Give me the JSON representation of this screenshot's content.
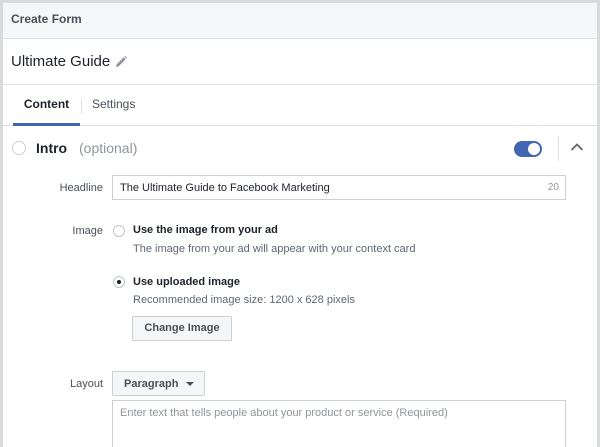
{
  "window": {
    "title": "Create Form"
  },
  "form": {
    "name": "Ultimate Guide"
  },
  "tabs": [
    {
      "label": "Content",
      "active": true
    },
    {
      "label": "Settings",
      "active": false
    }
  ],
  "section": {
    "title": "Intro",
    "optional_label": "(optional)",
    "enabled": true
  },
  "headline": {
    "label": "Headline",
    "value": "The Ultimate Guide to Facebook Marketing",
    "char_count": "20"
  },
  "image": {
    "label": "Image",
    "options": [
      {
        "title": "Use the image from your ad",
        "description": "The image from your ad will appear with your context card",
        "selected": false
      },
      {
        "title": "Use uploaded image",
        "description": "Recommended image size: 1200 x 628 pixels",
        "selected": true
      }
    ],
    "change_button": "Change Image"
  },
  "layout": {
    "label": "Layout",
    "selected": "Paragraph",
    "placeholder": "Enter text that tells people about your product or service (Required)"
  },
  "colors": {
    "accent": "#4267b2",
    "border": "#ccd0d5",
    "header_bg": "#f5f6f7"
  },
  "icons": {
    "edit": "pencil-icon",
    "collapse": "chevron-up-icon",
    "dropdown": "caret-down-icon"
  }
}
